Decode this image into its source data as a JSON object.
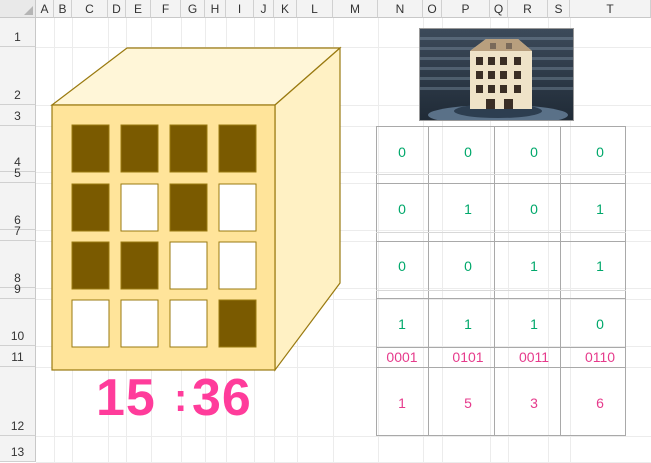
{
  "columns": [
    "A",
    "B",
    "C",
    "D",
    "E",
    "F",
    "G",
    "H",
    "I",
    "J",
    "K",
    "L",
    "M",
    "N",
    "O",
    "P",
    "Q",
    "R",
    "S",
    "T"
  ],
  "rows": [
    "1",
    "2",
    "3",
    "4",
    "5",
    "6",
    "7",
    "8",
    "9",
    "10",
    "11",
    "12",
    "13"
  ],
  "building": {
    "windows": [
      [
        1,
        1,
        1,
        1
      ],
      [
        1,
        0,
        1,
        0
      ],
      [
        1,
        1,
        0,
        0
      ],
      [
        0,
        0,
        0,
        1
      ]
    ],
    "colors": {
      "front": "#ffe49a",
      "side": "#fff1c4",
      "top": "#fff6d8",
      "edge": "#9a7a10",
      "lit": "#7a5a00",
      "unlit": "#ffffff"
    }
  },
  "photo": {
    "description_icon": "building-photo"
  },
  "bits": [
    [
      "0",
      "0",
      "0",
      "0"
    ],
    [
      "0",
      "1",
      "0",
      "1"
    ],
    [
      "0",
      "0",
      "1",
      "1"
    ],
    [
      "1",
      "1",
      "1",
      "0"
    ]
  ],
  "binary": [
    "0001",
    "0101",
    "0011",
    "0110"
  ],
  "decimal": [
    "1",
    "5",
    "3",
    "6"
  ],
  "time": {
    "hours": "15",
    "sep": ":",
    "minutes": "36"
  }
}
